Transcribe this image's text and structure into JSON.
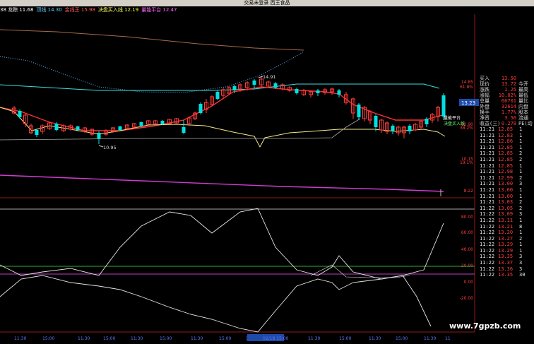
{
  "window": {
    "title": "交易未登录   西王食品"
  },
  "legend": [
    {
      "label": "38 龙踪",
      "value": "11.68",
      "color": "#ffffff"
    },
    {
      "label": "顶线",
      "value": "14.30",
      "color": "#5ad0ff"
    },
    {
      "label": "金线王",
      "value": "15.98",
      "color": "#ff5a5a"
    },
    {
      "label": "决盘买入线",
      "value": "12.19",
      "color": "#ffff55"
    },
    {
      "label": "量能平台",
      "value": "12.47",
      "color": "#ff66ff"
    }
  ],
  "price_axis": [
    "14.85",
    "61.8%",
    "12.90",
    "38.2%",
    "10.15",
    "19.1%",
    "8.22"
  ],
  "current_price_tag": "13.23",
  "chart_labels": {
    "high": "14.91",
    "low": "10.95",
    "platform": "量能平台",
    "buy_line": "决盘买入线"
  },
  "indicator_axis": [
    "80.00",
    "60.00",
    "40.00",
    "20.00",
    "0.00",
    "-20.00"
  ],
  "time_axis": [
    "11:30",
    "15:00",
    "11:30",
    "15:00",
    "11:30",
    "15:00",
    "11:30",
    "15:00",
    "15:00",
    "02/18 15:00",
    "11:30",
    "15:00",
    "11:30",
    "15:00",
    "11:30",
    "11"
  ],
  "quote": [
    {
      "label": "买入",
      "value": "13.50",
      "extra": ""
    },
    {
      "label": "现价",
      "value": "13.72",
      "extra": "今开"
    },
    {
      "label": "涨跌",
      "value": "1.25",
      "extra": "最高"
    },
    {
      "label": "涨幅",
      "value": "10.02%",
      "extra": "最低"
    },
    {
      "label": "总量",
      "value": "66701",
      "extra": "量比"
    },
    {
      "label": "外盘",
      "value": "32614",
      "extra": "内盘"
    },
    {
      "label": "换手",
      "value": "1.77%",
      "extra": "股本"
    },
    {
      "label": "净资",
      "value": "3.56",
      "extra": "流通"
    },
    {
      "label": "收益(三)",
      "value": "0.278",
      "extra": "PE(动"
    }
  ],
  "ticks": [
    {
      "time": "11:21",
      "price": "12.85",
      "vol": "1"
    },
    {
      "time": "11:21",
      "price": "12.83",
      "vol": "1"
    },
    {
      "time": "11:21",
      "price": "12.86",
      "vol": "1"
    },
    {
      "time": "11:21",
      "price": "12.85",
      "vol": "1"
    },
    {
      "time": "11:21",
      "price": "12.85",
      "vol": "2"
    },
    {
      "time": "11:21",
      "price": "12.85",
      "vol": "2"
    },
    {
      "time": "11:21",
      "price": "12.85",
      "vol": "1"
    },
    {
      "time": "11:21",
      "price": "12.98",
      "vol": "1"
    },
    {
      "time": "11:21",
      "price": "12.99",
      "vol": "2"
    },
    {
      "time": "11:21",
      "price": "13.00",
      "vol": "3"
    },
    {
      "time": "11:21",
      "price": "13.00",
      "vol": "1"
    },
    {
      "time": "11:21",
      "price": "13.00",
      "vol": "1"
    },
    {
      "time": "11:21",
      "price": "13.03",
      "vol": "2"
    },
    {
      "time": "11:22",
      "price": "13.05",
      "vol": "2"
    },
    {
      "time": "11:22",
      "price": "13.09",
      "vol": "3"
    },
    {
      "time": "11:22",
      "price": "13.11",
      "vol": "1"
    },
    {
      "time": "11:22",
      "price": "13.21",
      "vol": "8"
    },
    {
      "time": "11:22",
      "price": "13.20",
      "vol": "1"
    },
    {
      "time": "11:22",
      "price": "13.27",
      "vol": "2"
    },
    {
      "time": "11:22",
      "price": "13.29",
      "vol": "1"
    },
    {
      "time": "11:22",
      "price": "13.29",
      "vol": "1"
    },
    {
      "time": "11:22",
      "price": "13.35",
      "vol": "3"
    },
    {
      "time": "11:22",
      "price": "13.37",
      "vol": "3"
    },
    {
      "time": "11:22",
      "price": "13.36",
      "vol": "3"
    },
    {
      "time": "11:22",
      "price": "13.35",
      "vol": "30"
    }
  ],
  "watermark": "www.7gpzb.com",
  "colors": {
    "up": "#ff3c3c",
    "down": "#00e0e0",
    "bg": "#000000"
  }
}
